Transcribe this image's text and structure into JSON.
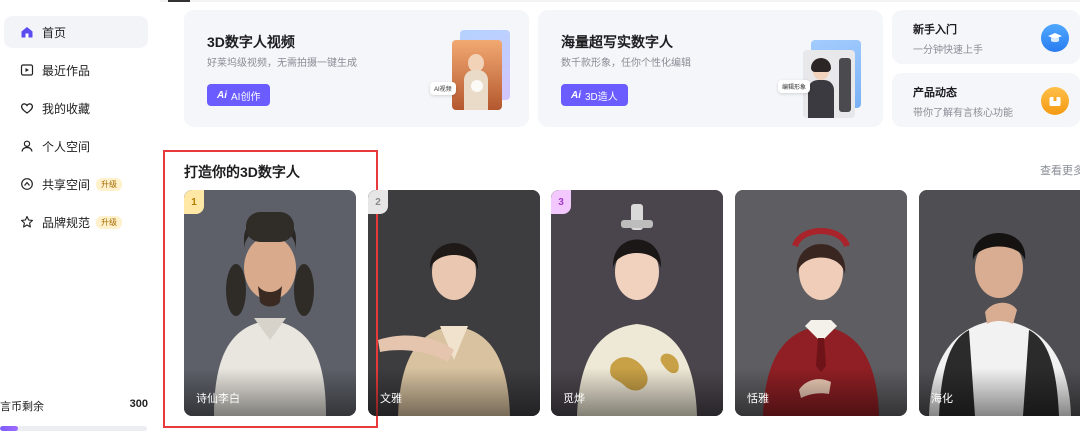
{
  "sidebar": {
    "items": [
      {
        "label": "首页",
        "icon": "home-icon",
        "active": true
      },
      {
        "label": "最近作品",
        "icon": "recent-works-icon"
      },
      {
        "label": "我的收藏",
        "icon": "heart-icon"
      },
      {
        "label": "个人空间",
        "icon": "user-icon"
      },
      {
        "label": "共享空间",
        "icon": "shared-space-icon",
        "badge": "升级"
      },
      {
        "label": "品牌规范",
        "icon": "brand-icon",
        "badge": "升级"
      }
    ],
    "coins": {
      "label": "言币剩余",
      "value": "300",
      "progress": 0.12
    }
  },
  "promos": {
    "video": {
      "title": "3D数字人视频",
      "subtitle": "好莱坞级视频，无需拍摄一键生成",
      "button": "AI创作",
      "button_prefix": "Ai",
      "tag": "AI视频"
    },
    "realistic": {
      "title": "海量超写实数字人",
      "subtitle": "数千款形象，任你个性化编辑",
      "button": "3D造人",
      "button_prefix": "Ai",
      "tag": "编辑形象"
    },
    "beginner": {
      "title": "新手入门",
      "subtitle": "一分钟快速上手",
      "icon": "graduation-cap-icon"
    },
    "news": {
      "title": "产品动态",
      "subtitle": "带你了解有言核心功能",
      "icon": "box-icon"
    }
  },
  "section": {
    "title": "打造你的3D数字人",
    "see_more": "查看更多",
    "avatars": [
      {
        "name": "诗仙李白",
        "rank": "1"
      },
      {
        "name": "文雅",
        "rank": "2"
      },
      {
        "name": "觅烨",
        "rank": "3"
      },
      {
        "name": "恬雅"
      },
      {
        "name": "海化"
      }
    ]
  },
  "colors": {
    "accent": "#6a5cff",
    "highlight": "#e83a3a",
    "badge_bg": "#fff1cc"
  }
}
